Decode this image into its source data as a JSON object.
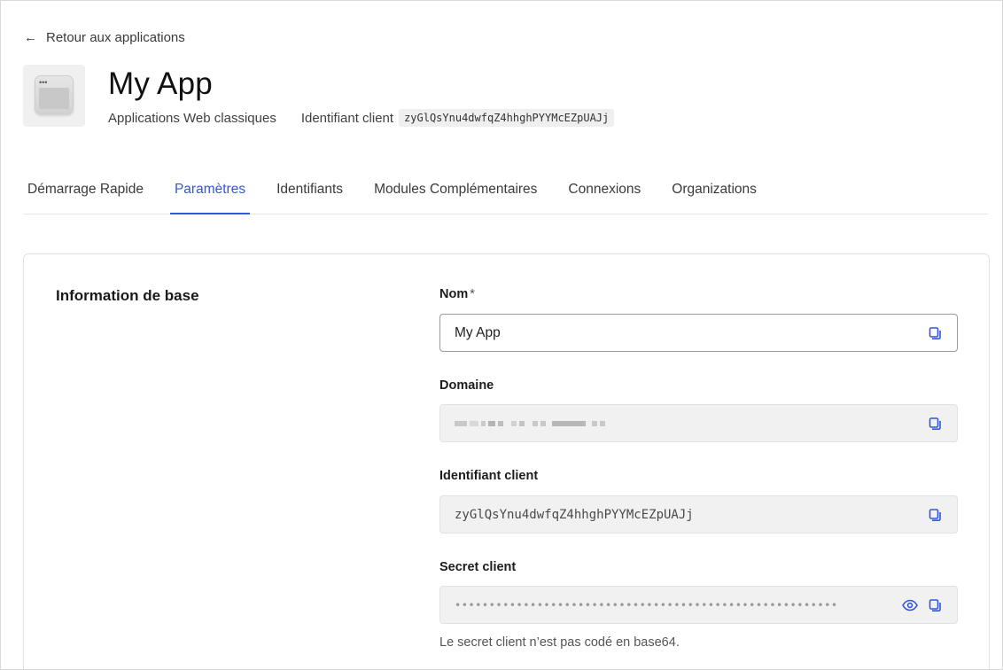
{
  "back": {
    "label": "Retour aux applications"
  },
  "app": {
    "name": "My App",
    "type": "Applications Web classiques",
    "client_id_label": "Identifiant client",
    "client_id": "zyGlQsYnu4dwfqZ4hhghPYYMcEZpUAJj"
  },
  "tabs": [
    {
      "label": "Démarrage Rapide",
      "active": false
    },
    {
      "label": "Paramètres",
      "active": true
    },
    {
      "label": "Identifiants",
      "active": false
    },
    {
      "label": "Modules Complémentaires",
      "active": false
    },
    {
      "label": "Connexions",
      "active": false
    },
    {
      "label": "Organizations",
      "active": false
    }
  ],
  "basic_info": {
    "title": "Information de base",
    "name_label": "Nom",
    "name_required_mark": "*",
    "name_value": "My App",
    "domain_label": "Domaine",
    "client_id_label": "Identifiant client",
    "client_id_value": "zyGlQsYnu4dwfqZ4hhghPYYMcEZpUAJj",
    "secret_label": "Secret client",
    "secret_masked": "••••••••••••••••••••••••••••••••••••••••••••••••••••••••",
    "secret_hint": "Le secret client n’est pas codé en base64."
  },
  "colors": {
    "accent": "#3456d8",
    "readonly_bg": "#f1f1f1"
  },
  "icons": {
    "back": "arrow-left-icon",
    "copy": "copy-icon",
    "reveal": "eye-icon",
    "app": "browser-window-icon"
  }
}
